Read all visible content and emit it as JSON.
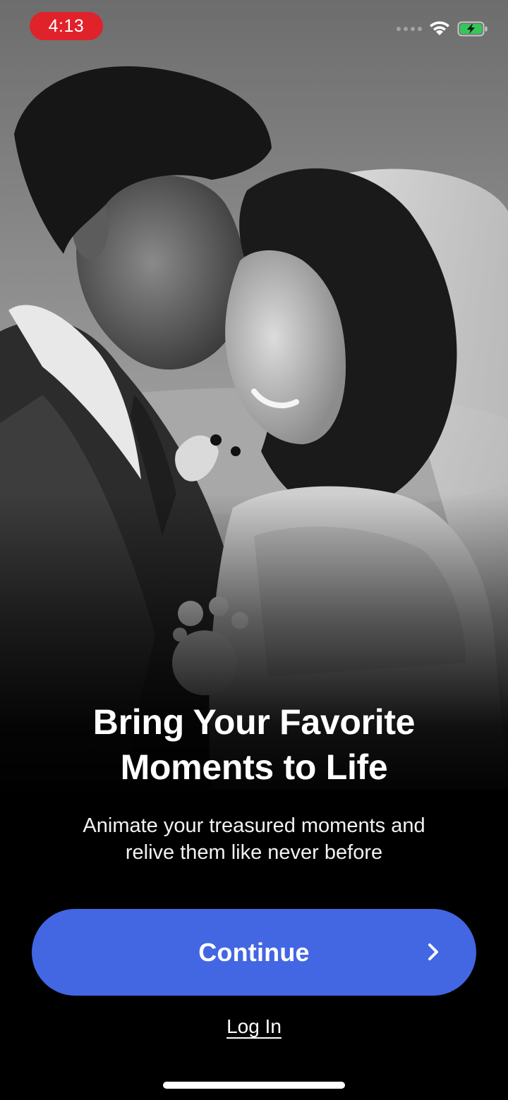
{
  "status_bar": {
    "time": "4:13",
    "time_pill_color": "#e0222b",
    "battery_state": "charging",
    "wifi": "full"
  },
  "hero": {
    "image_icon": "wedding-portrait-photo"
  },
  "onboarding": {
    "headline_line1": "Bring Your Favorite",
    "headline_line2": "Moments to Life",
    "subtitle_line1": "Animate your treasured moments and",
    "subtitle_line2": "relive them like never before"
  },
  "actions": {
    "continue_label": "Continue",
    "continue_color": "#4366e3",
    "continue_icon": "chevron-right-icon",
    "login_label": "Log In"
  }
}
